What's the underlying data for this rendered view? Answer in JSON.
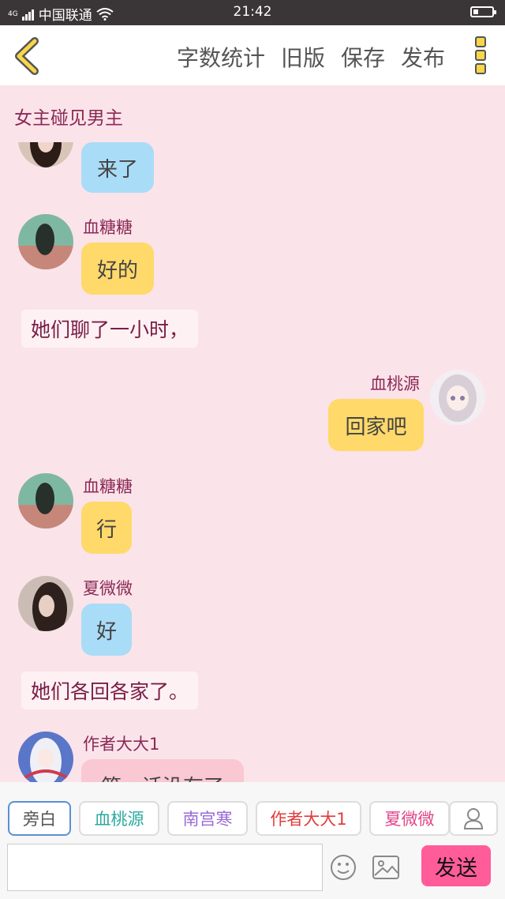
{
  "status_bar": {
    "network": "4G",
    "carrier": "中国联通",
    "time": "21:42"
  },
  "toolbar": {
    "actions": [
      "字数统计",
      "旧版",
      "保存",
      "发布"
    ]
  },
  "chapter_title": "女主碰见男主",
  "messages": [
    {
      "type": "bubble",
      "text": "来了",
      "color": "#a9dcf7"
    },
    {
      "type": "bubble",
      "speaker": "血糖糖",
      "text": "好的",
      "color": "#ffd96a"
    },
    {
      "type": "narration",
      "text": "她们聊了一小时，"
    },
    {
      "type": "bubble",
      "speaker": "血桃源",
      "text": "回家吧",
      "color": "#ffd96a"
    },
    {
      "type": "bubble",
      "speaker": "血糖糖",
      "text": "行",
      "color": "#ffd96a"
    },
    {
      "type": "bubble",
      "speaker": "夏微微",
      "text": "好",
      "color": "#a9dcf7"
    },
    {
      "type": "narration",
      "text": "她们各回各家了。"
    },
    {
      "type": "bubble",
      "speaker": "作者大大1",
      "text": "第一话没有了",
      "color": "#f9c8d2"
    }
  ],
  "role_chips": [
    {
      "label": "旁白",
      "color": "#555555"
    },
    {
      "label": "血桃源",
      "color": "#2aa9a0"
    },
    {
      "label": "南宫寒",
      "color": "#9a6bd6"
    },
    {
      "label": "作者大大1",
      "color": "#e23b3b"
    },
    {
      "label": "夏微微",
      "color": "#e2468a"
    }
  ],
  "composer": {
    "input_value": "",
    "send_label": "发送"
  }
}
